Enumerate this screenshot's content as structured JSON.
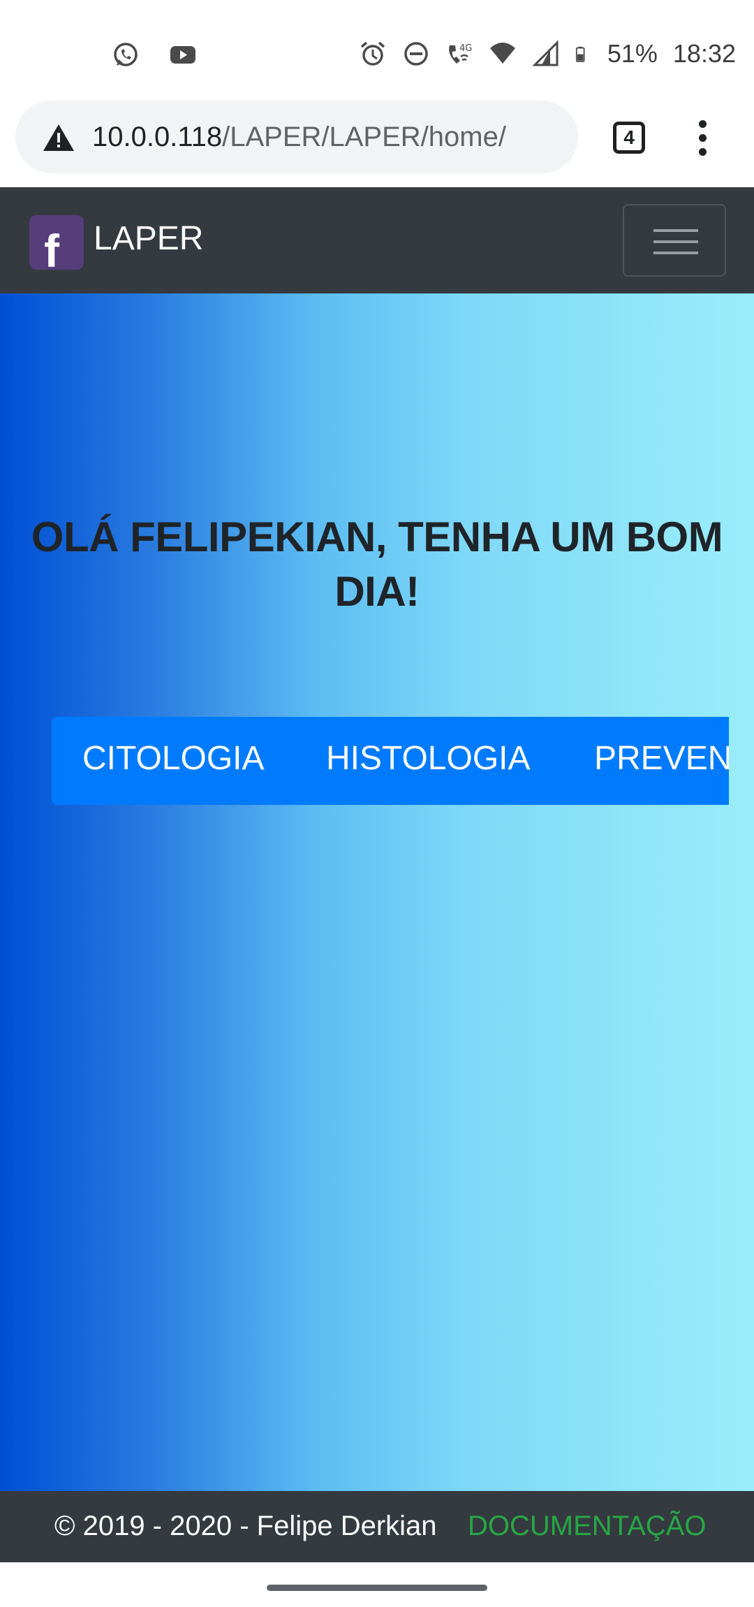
{
  "status_bar": {
    "left_icons": [
      "whatsapp-icon",
      "youtube-icon"
    ],
    "right_icons": [
      "alarm-icon",
      "do-not-disturb-icon",
      "volte-4g-icon",
      "wifi-icon",
      "signal-icon",
      "battery-icon"
    ],
    "battery": "51%",
    "time": "18:32"
  },
  "browser": {
    "url_host": "10.0.0.118",
    "url_path": "/LAPER/LAPER/home/",
    "security_icon": "warning-icon",
    "tab_count": "4",
    "menu_icon": "overflow-menu-icon"
  },
  "navbar": {
    "logo_letter": "f",
    "brand": "LAPER",
    "toggler_icon": "hamburger-icon"
  },
  "hero": {
    "greeting": "OLÁ FELIPEKIAN, TENHA UM BOM DIA!",
    "menu_items": [
      "CITOLOGIA",
      "HISTOLOGIA",
      "PREVEN"
    ]
  },
  "footer": {
    "copyright": "© 2019 - 2020 - Felipe Derkian",
    "documentation": "DOCUMENTAÇÃO"
  },
  "colors": {
    "navbar_bg": "#343a40",
    "menu_bg": "#007bff",
    "doc_link": "#28a745",
    "logo_bg": "#563d7c",
    "gradient_start": "#004fd4",
    "gradient_end": "#9aeefa"
  }
}
